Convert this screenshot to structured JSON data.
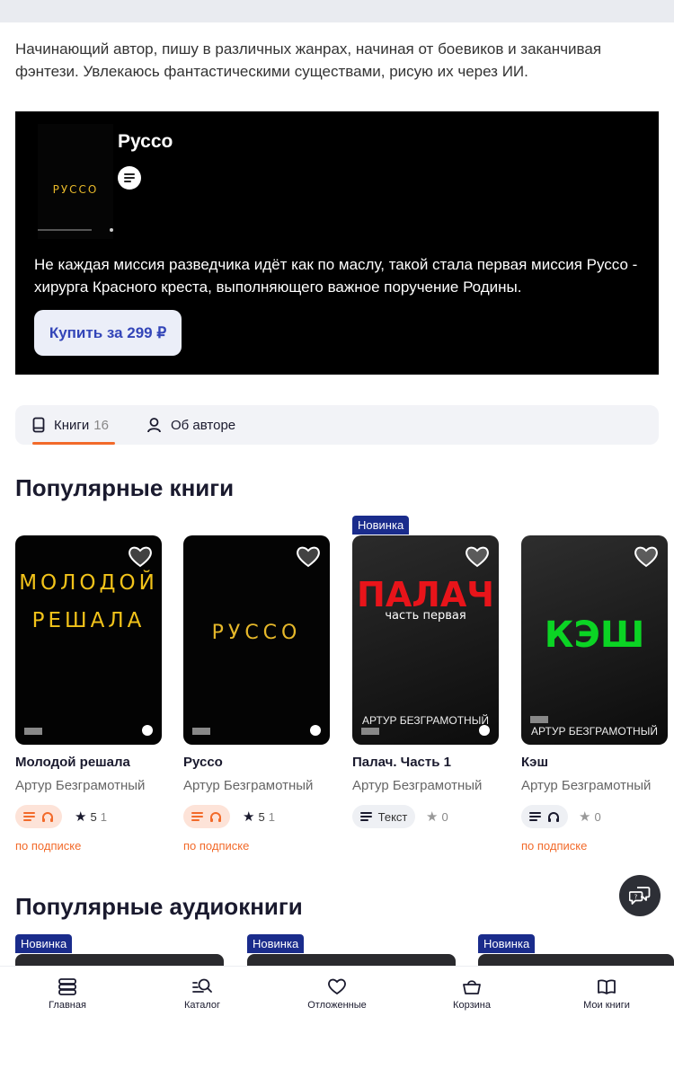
{
  "author_bio": "Начинающий автор, пишу в различных жанрах, начиная от боевиков и заканчивая фэнтези. Увлекаюсь фантастическими существами, рисую их через ИИ.",
  "promo": {
    "title": "Руссо",
    "cover_text": "РУССО",
    "description": "Не каждая миссия разведчика идёт как по маслу, такой стала первая миссия Руссо - хирурга Красного креста, выполняющего важное поручение Родины.",
    "buy_label": "Купить за 299 ₽"
  },
  "tabs": [
    {
      "label": "Книги",
      "count": "16"
    },
    {
      "label": "Об авторе"
    }
  ],
  "sections": {
    "popular_books": "Популярные книги",
    "popular_audiobooks": "Популярные аудиокниги"
  },
  "badge_new": "Новинка",
  "books": [
    {
      "title": "Молодой решала",
      "author": "Артур Безграмотный",
      "cover_line1": "МОЛОДОЙ",
      "cover_line2": "РЕШАЛА",
      "rating": "5",
      "count": "1",
      "subscription": "по подписке"
    },
    {
      "title": "Руссо",
      "author": "Артур Безграмотный",
      "cover_line1": "РУССО",
      "rating": "5",
      "count": "1",
      "subscription": "по подписке"
    },
    {
      "title": "Палач. Часть 1",
      "author": "Артур Безграмотный",
      "cover_line1": "ПАЛАЧ",
      "cover_sub": "часть первая",
      "cover_author": "АРТУР БЕЗГРАМОТНЫЙ",
      "format": "Текст",
      "count": "0",
      "is_new": true
    },
    {
      "title": "Кэш",
      "author": "Артур Безграмотный",
      "cover_line1": "КЭШ",
      "cover_author": "АРТУР БЕЗГРАМОТНЫЙ",
      "count": "0",
      "subscription": "по подписке"
    }
  ],
  "nav": [
    {
      "label": "Главная"
    },
    {
      "label": "Каталог"
    },
    {
      "label": "Отложенные"
    },
    {
      "label": "Корзина"
    },
    {
      "label": "Мои книги"
    }
  ],
  "colors": {
    "accent": "#f26a2a",
    "badge": "#1a2c8c",
    "button_text": "#3345b8"
  }
}
